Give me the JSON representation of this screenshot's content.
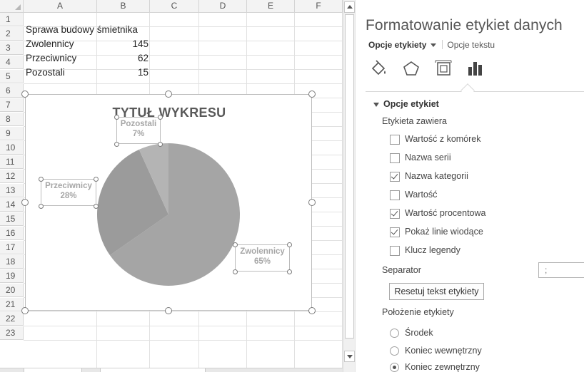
{
  "sheet": {
    "columns": [
      "A",
      "B",
      "C",
      "D",
      "E",
      "F"
    ],
    "rows": [
      "1",
      "2",
      "3",
      "4",
      "5",
      "6",
      "7",
      "8",
      "9",
      "10",
      "11",
      "12",
      "13",
      "14",
      "15",
      "16",
      "17",
      "18",
      "19",
      "20",
      "21",
      "22",
      "23"
    ],
    "cells": {
      "a1": "Sprawa budowy śmietnika",
      "a2": "Zwolennicy",
      "b2": "145",
      "a3": "Przeciwnicy",
      "b3": "62",
      "a4": "Pozostali",
      "b4": "15"
    }
  },
  "chart_data": {
    "type": "pie",
    "title": "TYTUŁ WYKRESU",
    "categories": [
      "Zwolennicy",
      "Przeciwnicy",
      "Pozostali"
    ],
    "values": [
      145,
      62,
      15
    ],
    "percent_labels": [
      "65%",
      "28%",
      "7%"
    ],
    "colors": [
      "#a5a5a5",
      "#9b9b9b",
      "#b4b4b4"
    ],
    "legend": "none"
  },
  "pane": {
    "title": "Formatowanie etykiet danych",
    "tab_active": "Opcje etykiety",
    "tab_other": "Opcje tekstu",
    "icons": [
      "fill-line-icon",
      "effects-pentagon-icon",
      "size-properties-icon",
      "bar-chart-icon"
    ],
    "section_title": "Opcje etykiet",
    "label_contains": "Etykieta zawiera",
    "options": {
      "o1": "Wartość z komórek",
      "o2": "Nazwa serii",
      "o3": "Nazwa kategorii",
      "o4": "Wartość",
      "o5": "Wartość procentowa",
      "o6": "Pokaż linie wiodące",
      "o7": "Klucz legendy"
    },
    "separator_label": "Separator",
    "separator_value": ";",
    "reset_label": "Resetuj tekst etykiety",
    "position_title": "Położenie etykiety",
    "positions": {
      "p1": "Środek",
      "p2": "Koniec wewnętrzny",
      "p3": "Koniec zewnętrzny"
    }
  }
}
